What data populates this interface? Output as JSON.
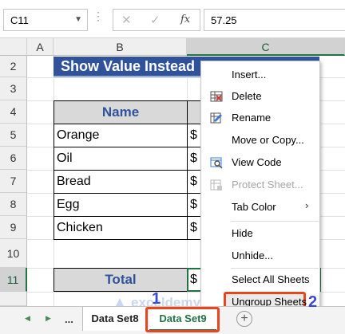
{
  "formula_bar": {
    "name_box": "C11",
    "formula_value": "57.25",
    "cancel_glyph": "✕",
    "enter_glyph": "✓",
    "fx_label": "fx"
  },
  "columns": [
    "A",
    "B",
    "C"
  ],
  "rows": [
    "1",
    "2",
    "3",
    "4",
    "5",
    "6",
    "7",
    "8",
    "9",
    "10",
    "11"
  ],
  "title_banner": "Show Value Instead",
  "table": {
    "header": "Name",
    "items": [
      {
        "name": "Orange",
        "value": "$"
      },
      {
        "name": "Oil",
        "value": "$"
      },
      {
        "name": "Bread",
        "value": "$"
      },
      {
        "name": "Egg",
        "value": "$"
      },
      {
        "name": "Chicken",
        "value": "$"
      }
    ],
    "total_label": "Total",
    "total_value": "$"
  },
  "context_menu": {
    "items": [
      {
        "label": "Insert...",
        "icon": "none",
        "disabled": false
      },
      {
        "label": "Delete",
        "icon": "delete-sheet-icon",
        "disabled": false
      },
      {
        "label": "Rename",
        "icon": "rename-icon",
        "disabled": false
      },
      {
        "label": "Move or Copy...",
        "icon": "none",
        "disabled": false
      },
      {
        "label": "View Code",
        "icon": "view-code-icon",
        "disabled": false
      },
      {
        "label": "Protect Sheet...",
        "icon": "protect-sheet-icon",
        "disabled": true
      },
      {
        "label": "Tab Color",
        "icon": "none",
        "disabled": false,
        "submenu": true
      },
      {
        "label": "Hide",
        "icon": "none",
        "disabled": false
      },
      {
        "label": "Unhide...",
        "icon": "none",
        "disabled": false
      },
      {
        "label": "Select All Sheets",
        "icon": "none",
        "disabled": false
      },
      {
        "label": "Ungroup Sheets",
        "icon": "none",
        "disabled": false
      }
    ],
    "submenu_glyph": "›"
  },
  "sheet_tabs": {
    "nav_prev": "◀",
    "nav_next": "▶",
    "ellipsis": "...",
    "tabs": [
      {
        "label": "Data Set8",
        "active": false
      },
      {
        "label": "Data Set9",
        "active": true
      }
    ],
    "add_sheet_glyph": "+"
  },
  "annotations": {
    "step1": "1",
    "step2": "2"
  },
  "watermark": {
    "text": "exceldemy",
    "sub": "EXCEL · DATA · BI"
  },
  "colors": {
    "excel_green": "#217346",
    "banner_blue": "#2f529a",
    "highlight_red": "#e8461e",
    "annotation_blue": "#3a4bd0"
  }
}
